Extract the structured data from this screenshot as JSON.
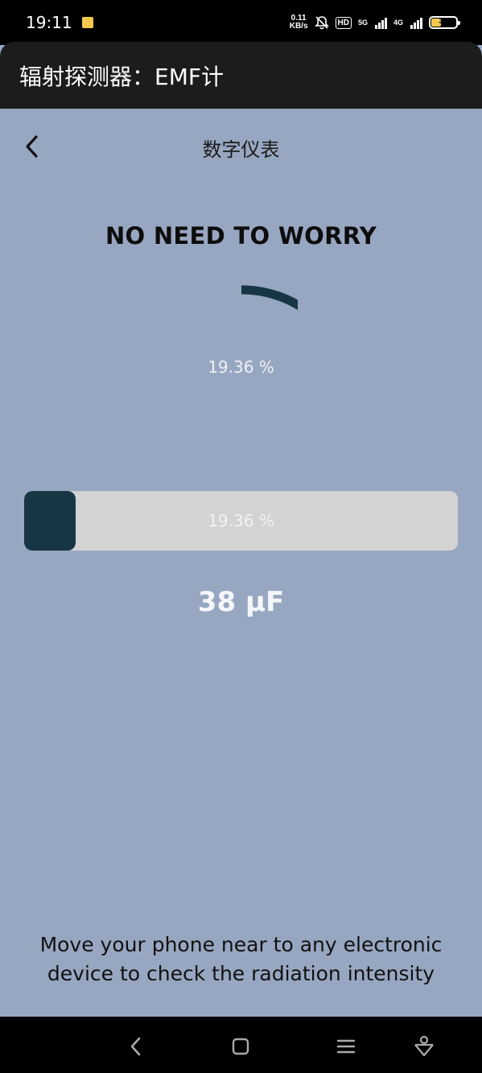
{
  "status_bar": {
    "time": "19:11",
    "net_speed_value": "0.11",
    "net_speed_unit": "KB/s",
    "hd_badge": "HD",
    "net1_label": "5G",
    "net2_label": "4G",
    "battery_level": "39"
  },
  "app_bar": {
    "title": "辐射探测器：EMF计"
  },
  "header": {
    "title": "数字仪表"
  },
  "meter": {
    "status_text": "NO NEED TO WORRY",
    "gauge_percent_text": "19.36 %",
    "percent_value": 19.36,
    "progress_text": "19.36 %",
    "reading_text": "38 μF"
  },
  "instruction": {
    "text": "Move your phone near to any electronic device to check the radiation intensity"
  },
  "colors": {
    "background": "#98a7c1",
    "accent": "#173643",
    "track": "#d3d3d3"
  }
}
